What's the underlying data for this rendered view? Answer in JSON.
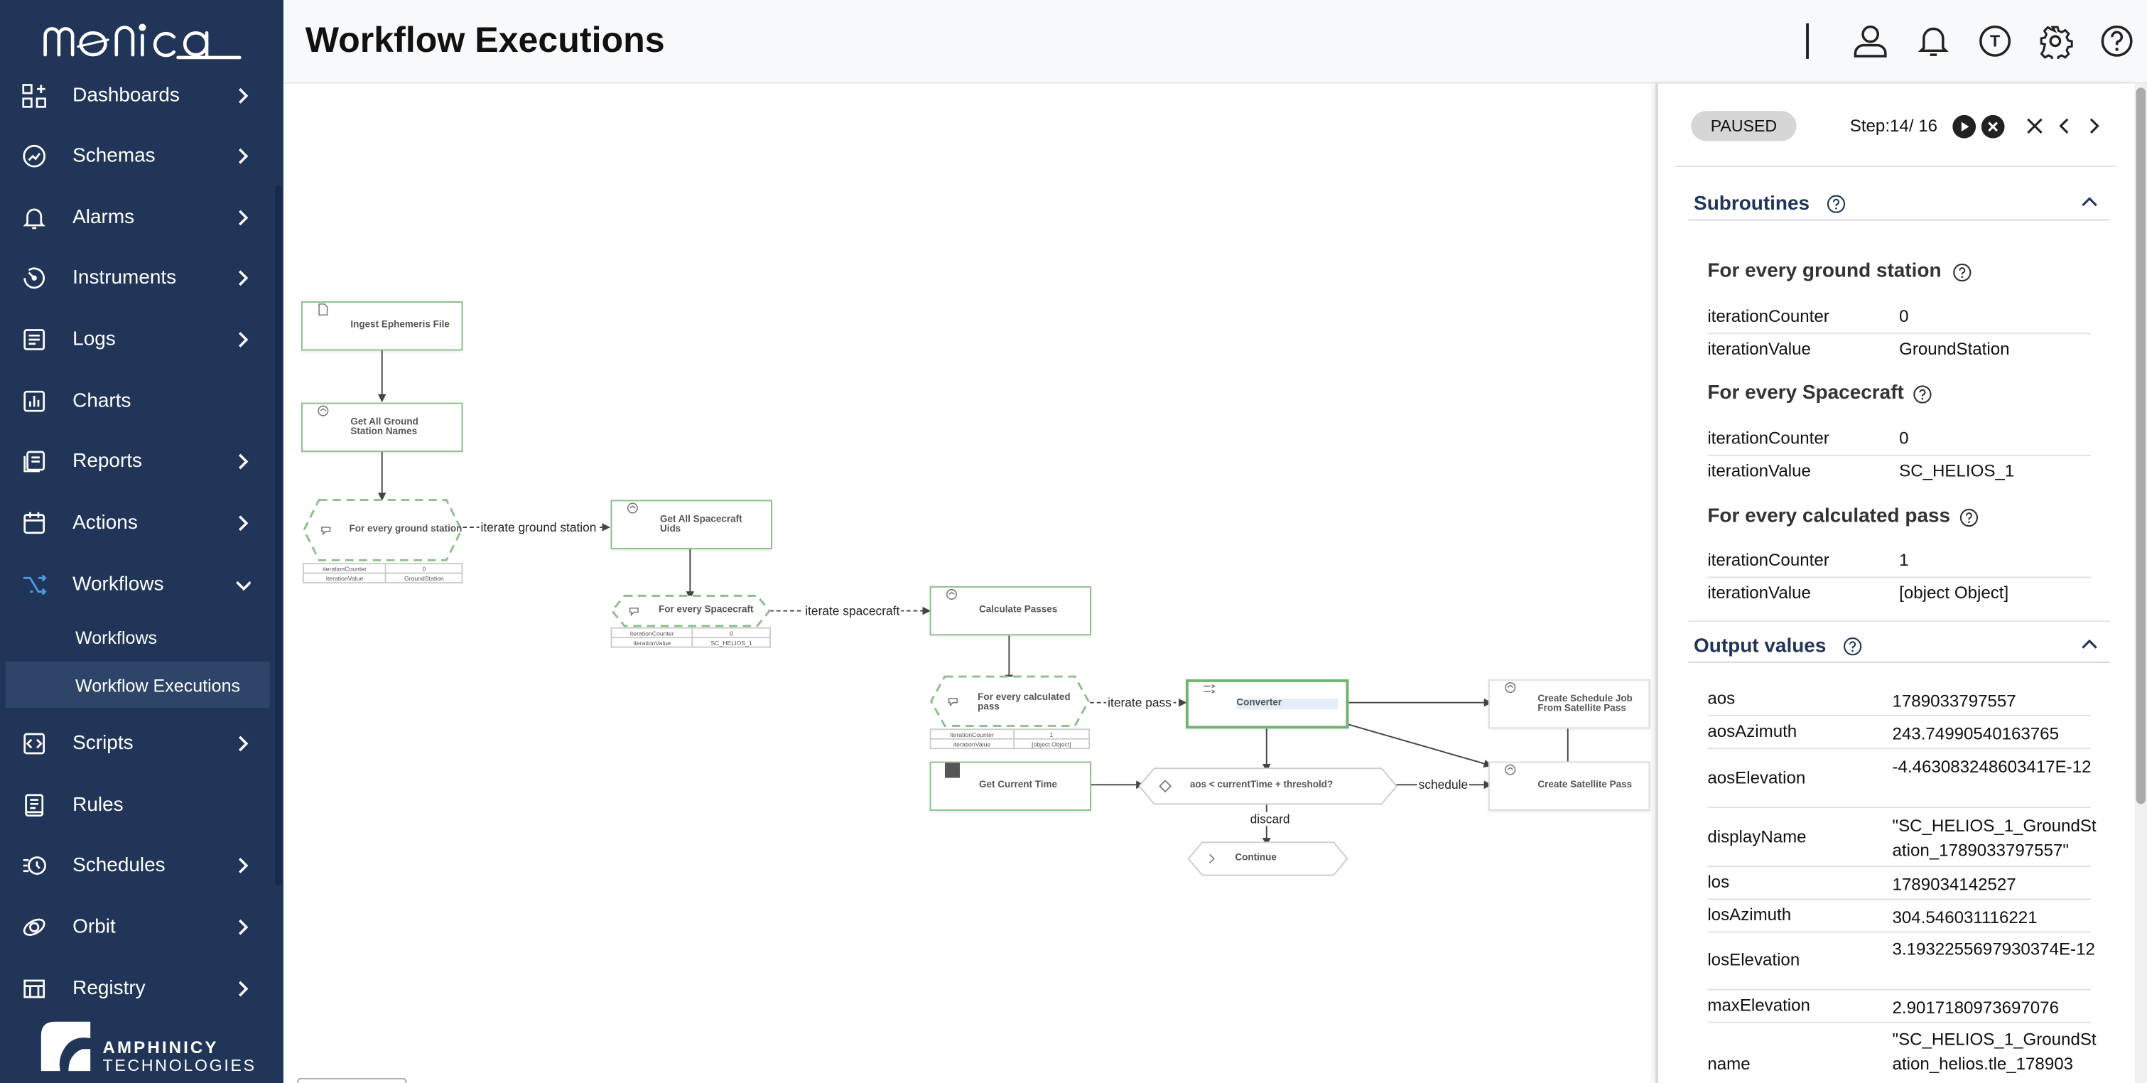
{
  "app": {
    "brand": "monica",
    "company_line1": "AMPHINICY",
    "company_line2": "TECHNOLOGIES"
  },
  "page_title": "Workflow Executions",
  "sidebar": {
    "items": [
      {
        "label": "Dashboards",
        "icon": "dashboard-icon",
        "expandable": true
      },
      {
        "label": "Schemas",
        "icon": "schema-icon",
        "expandable": true
      },
      {
        "label": "Alarms",
        "icon": "bell-icon",
        "expandable": true
      },
      {
        "label": "Instruments",
        "icon": "gauge-icon",
        "expandable": true
      },
      {
        "label": "Logs",
        "icon": "log-icon",
        "expandable": true
      },
      {
        "label": "Charts",
        "icon": "chart-icon",
        "expandable": false
      },
      {
        "label": "Reports",
        "icon": "report-icon",
        "expandable": true
      },
      {
        "label": "Actions",
        "icon": "calendar-icon",
        "expandable": true
      },
      {
        "label": "Workflows",
        "icon": "workflow-icon",
        "expandable": true,
        "expanded": true
      },
      {
        "label": "Scripts",
        "icon": "code-icon",
        "expandable": true
      },
      {
        "label": "Rules",
        "icon": "rules-icon",
        "expandable": false
      },
      {
        "label": "Schedules",
        "icon": "schedule-icon",
        "expandable": true
      },
      {
        "label": "Orbit",
        "icon": "orbit-icon",
        "expandable": true
      },
      {
        "label": "Registry",
        "icon": "registry-icon",
        "expandable": true
      }
    ],
    "workflow_subitems": [
      {
        "label": "Workflows",
        "active": false
      },
      {
        "label": "Workflow Executions",
        "active": true
      }
    ]
  },
  "header_icons": [
    "user-icon",
    "bell-icon",
    "tenant-icon",
    "gear-icon",
    "help-icon"
  ],
  "header_tenant_letter": "T",
  "workflow": {
    "nodes": {
      "ingest": "Ingest Ephemeris File",
      "get_gs": "Get All Ground Station Names",
      "for_gs": "For every ground station",
      "get_sc": "Get All Spacecraft Uids",
      "for_sc": "For every Spacecraft",
      "calc": "Calculate Passes",
      "for_pass": "For every calculated pass",
      "converter": "Converter",
      "sched_job": "Create Schedule Job From Satellite Pass",
      "get_time": "Get Current Time",
      "cond": "aos < currentTime + threshold?",
      "create_pass": "Create Satellite Pass",
      "continue": "Continue"
    },
    "edge_labels": {
      "iter_gs": "iterate ground station",
      "iter_sc": "iterate spacecraft",
      "iter_pass": "iterate pass",
      "schedule": "schedule",
      "discard": "discard"
    },
    "mini_tables": {
      "gs": [
        [
          "iterationCounter",
          "0"
        ],
        [
          "iterationValue",
          "GroundStation"
        ]
      ],
      "sc": [
        [
          "iterationCounter",
          "0"
        ],
        [
          "iterationValue",
          "SC_HELIOS_1"
        ]
      ],
      "pass": [
        [
          "iterationCounter",
          "1"
        ],
        [
          "iterationValue",
          "[object Object]"
        ]
      ]
    }
  },
  "panel": {
    "status": "PAUSED",
    "step": "Step:14/ 16",
    "subroutines_title": "Subroutines",
    "subroutines": [
      {
        "title": "For every ground station",
        "rows": [
          {
            "k": "iterationCounter",
            "v": "0"
          },
          {
            "k": "iterationValue",
            "v": "GroundStation"
          }
        ]
      },
      {
        "title": "For every Spacecraft",
        "rows": [
          {
            "k": "iterationCounter",
            "v": "0"
          },
          {
            "k": "iterationValue",
            "v": "SC_HELIOS_1"
          }
        ]
      },
      {
        "title": "For every calculated pass",
        "rows": [
          {
            "k": "iterationCounter",
            "v": "1"
          },
          {
            "k": "iterationValue",
            "v": "[object Object]"
          }
        ]
      }
    ],
    "output_title": "Output values",
    "outputs": [
      {
        "k": "aos",
        "v": "1789033797557"
      },
      {
        "k": "aosAzimuth",
        "v": "243.74990540163765"
      },
      {
        "k": "aosElevation",
        "v": "-4.463083248603417E-12"
      },
      {
        "k": "displayName",
        "v": "\"SC_HELIOS_1_GroundStation_1789033797557\""
      },
      {
        "k": "los",
        "v": "1789034142527"
      },
      {
        "k": "losAzimuth",
        "v": "304.546031116221"
      },
      {
        "k": "losElevation",
        "v": "3.1932255697930374E-12"
      },
      {
        "k": "maxElevation",
        "v": "2.9017180973697076"
      },
      {
        "k": "name",
        "v": "\"SC_HELIOS_1_GroundStation_helios.tle_178903"
      }
    ]
  }
}
